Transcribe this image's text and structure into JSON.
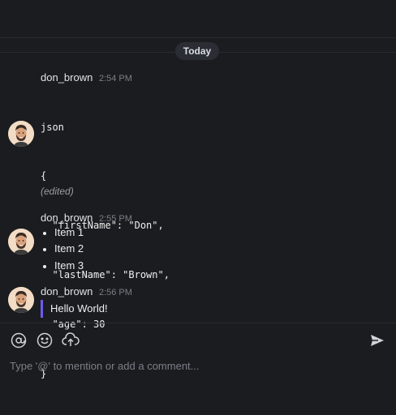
{
  "day_divider": {
    "label": "Today"
  },
  "messages": [
    {
      "author": "don_brown",
      "time": "2:54 PM",
      "code_lines": [
        "json",
        "{",
        "  \"firstName\": \"Don\",",
        "  \"lastName\": \"Brown\",",
        "  \"age\": 30",
        "}"
      ],
      "edited_label": "(edited)"
    },
    {
      "author": "don_brown",
      "time": "2:55 PM",
      "items": [
        "Item 1",
        "Item 2",
        "Item 3"
      ]
    },
    {
      "author": "don_brown",
      "time": "2:56 PM",
      "quote": "Hello World!"
    }
  ],
  "composer": {
    "placeholder": "Type '@' to mention or add a comment...",
    "tools": [
      "at-mention-icon",
      "emoji-icon",
      "upload-icon"
    ],
    "send_icon": "send-icon"
  },
  "colors": {
    "quote_border": "#6a5cf0",
    "background": "#1b1c20"
  }
}
